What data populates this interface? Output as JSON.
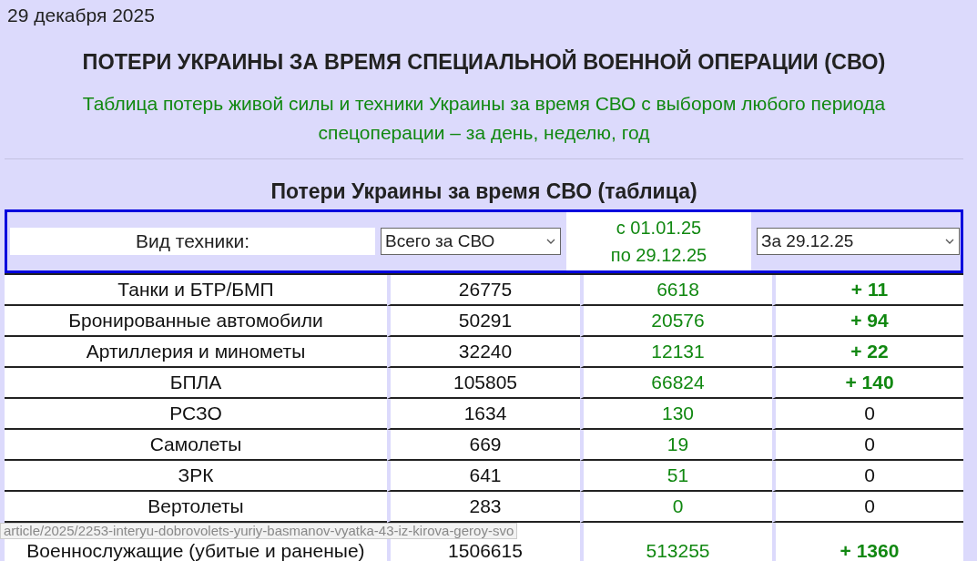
{
  "date": "29 декабря 2025",
  "title": "ПОТЕРИ УКРАИНЫ ЗА ВРЕМЯ СПЕЦИАЛЬНОЙ ВОЕННОЙ ОПЕРАЦИИ (СВО)",
  "subtitle": "Таблица потерь живой силы и техники Украины за время СВО с выбором любого периода спецоперации – за день, неделю, год",
  "table": {
    "heading": "Потери Украины за время СВО (таблица)",
    "filter": {
      "label": "Вид техники:",
      "period_select": "Всего за СВО",
      "range_from": "с 01.01.25",
      "range_to": "по 29.12.25",
      "day_select": "За 29.12.25"
    },
    "rows": [
      {
        "name": "Танки и БТР/БМП",
        "total": "26775",
        "period": "6618",
        "day": "+ 11",
        "day_increase": true
      },
      {
        "name": "Бронированные автомобили",
        "total": "50291",
        "period": "20576",
        "day": "+ 94",
        "day_increase": true
      },
      {
        "name": "Артиллерия и минометы",
        "total": "32240",
        "period": "12131",
        "day": "+ 22",
        "day_increase": true
      },
      {
        "name": "БПЛА",
        "total": "105805",
        "period": "66824",
        "day": "+ 140",
        "day_increase": true
      },
      {
        "name": "РСЗО",
        "total": "1634",
        "period": "130",
        "day": "0",
        "day_increase": false
      },
      {
        "name": "Самолеты",
        "total": "669",
        "period": "19",
        "day": "0",
        "day_increase": false
      },
      {
        "name": "ЗРК",
        "total": "641",
        "period": "51",
        "day": "0",
        "day_increase": false
      },
      {
        "name": "Вертолеты",
        "total": "283",
        "period": "0",
        "day": "0",
        "day_increase": false
      },
      {
        "name": "Военнослужащие (убитые и раненые)",
        "total": "1506615",
        "period": "513255",
        "day": "+ 1360",
        "day_increase": true
      }
    ]
  },
  "status_link": "article/2025/2253-interyu-dobrovolets-yuriy-basmanov-vyatka-43-iz-kirova-geroy-svo"
}
